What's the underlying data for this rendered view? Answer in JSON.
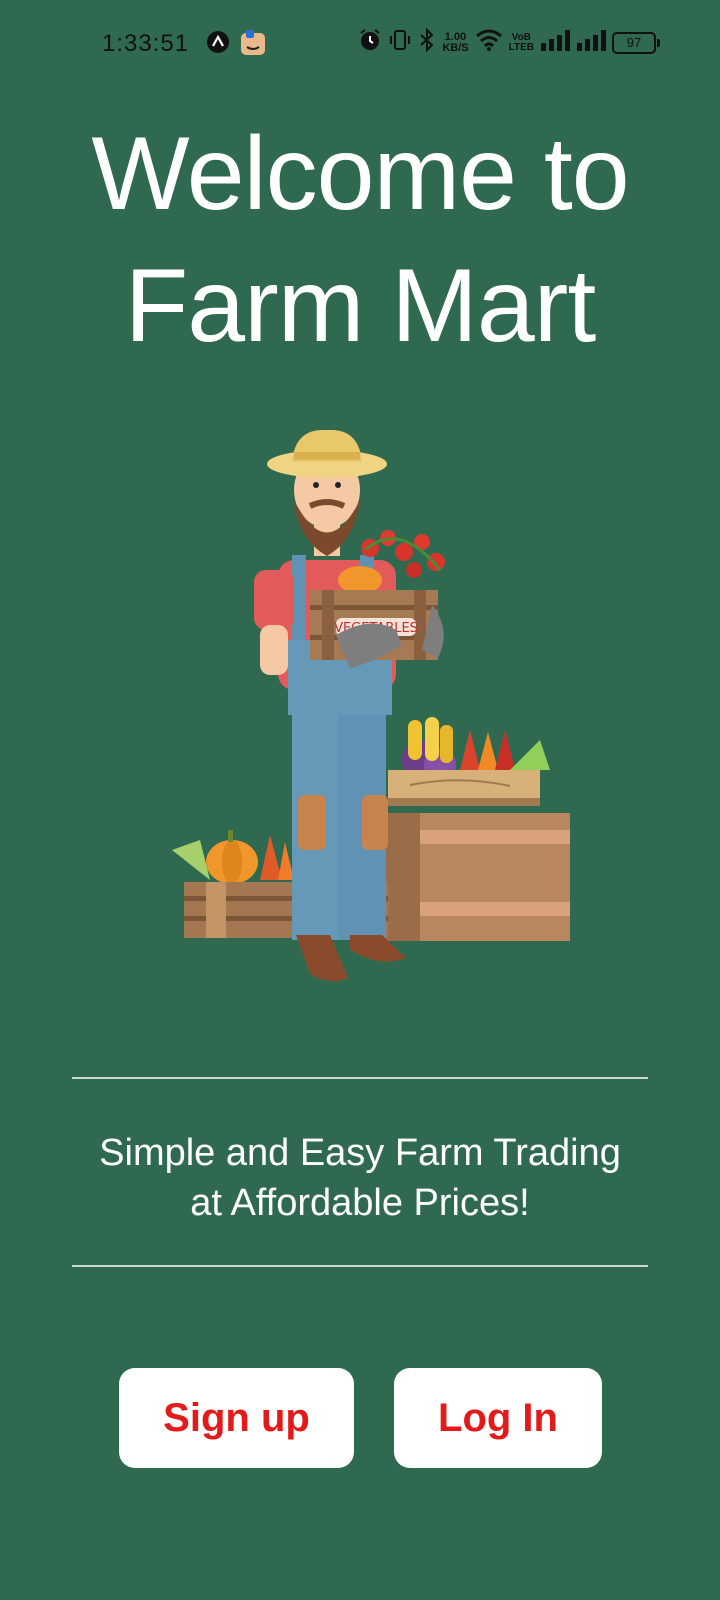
{
  "status_bar": {
    "time": "1:33:51",
    "net_speed_value": "1.00",
    "net_speed_unit": "KB/S",
    "volte_top": "VoB",
    "volte_bottom": "LTEB",
    "battery": "97"
  },
  "header": {
    "title_line1": "Welcome to",
    "title_line2": "Farm Mart"
  },
  "illustration": {
    "crate_label": "VEGETABLES"
  },
  "tagline": {
    "line1": "Simple and Easy Farm Trading",
    "line2": "at Affordable Prices!"
  },
  "actions": {
    "signup_label": "Sign up",
    "login_label": "Log In"
  },
  "colors": {
    "background": "#2f6a50",
    "button_bg": "#ffffff",
    "button_text": "#e31a1a"
  }
}
